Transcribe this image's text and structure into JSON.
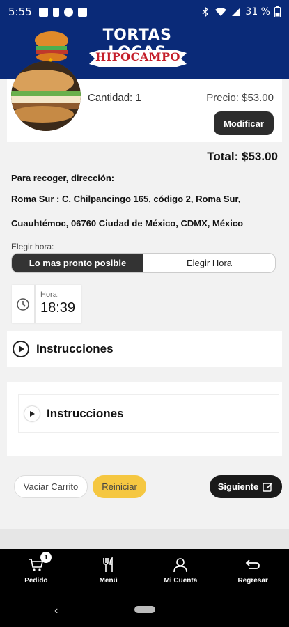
{
  "status_bar": {
    "time": "5:55",
    "battery": "31 %"
  },
  "header": {
    "brand_title": "TORTAS LOCAS",
    "brand_subtitle": "HIPOCAMPO"
  },
  "cart_item": {
    "quantity_text": "Cantidad: 1",
    "price_text": "Precio: $53.00",
    "modify_label": "Modificar"
  },
  "total_text": "Total: $53.00",
  "pickup": {
    "label": "Para recoger, dirección:",
    "address": "Roma Sur : C. Chilpancingo 165, código 2, Roma Sur, Cuauhtémoc, 06760 Ciudad de México, CDMX, México"
  },
  "time_choice": {
    "label": "Elegir hora:",
    "options": [
      "Lo mas pronto posible",
      "Elegir Hora"
    ],
    "selected": "Lo mas pronto posible",
    "hora_label": "Hora:",
    "hora_value": "18:39"
  },
  "instructions": {
    "first_label": "Instrucciones",
    "second_label": "Instrucciones"
  },
  "actions": {
    "clear_label": "Vaciar Carrito",
    "reset_label": "Reiniciar",
    "next_label": "Siguiente"
  },
  "bottom_nav": {
    "items": [
      {
        "label": "Pedido",
        "icon": "cart-icon",
        "badge": "1"
      },
      {
        "label": "Menú",
        "icon": "cutlery-icon"
      },
      {
        "label": "Mi Cuenta",
        "icon": "user-icon"
      },
      {
        "label": "Regresar",
        "icon": "return-icon"
      }
    ]
  },
  "colors": {
    "header_bg": "#0a2a78",
    "accent_yellow": "#f5c741",
    "dark_button": "#2d2d2d",
    "brand_red": "#c41e2a"
  }
}
